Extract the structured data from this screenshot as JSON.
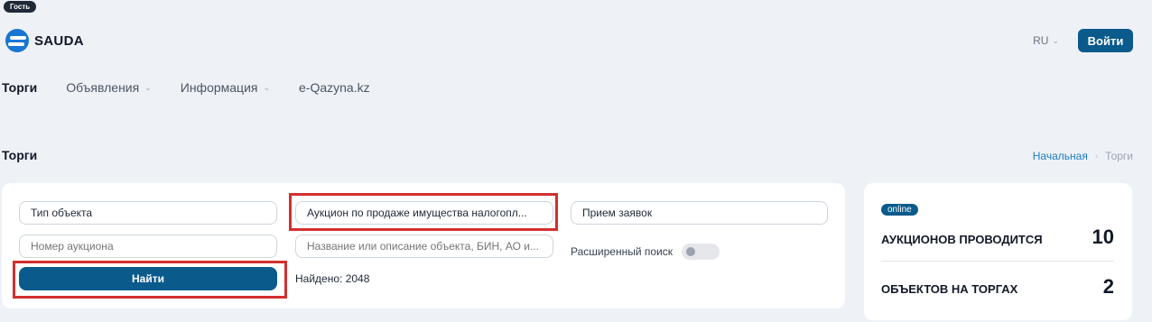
{
  "header": {
    "guest_badge": "Гость",
    "logo_text": "SAUDA",
    "language": "RU",
    "login_label": "Войти"
  },
  "nav": {
    "items": [
      {
        "label": "Торги"
      },
      {
        "label": "Объявления"
      },
      {
        "label": "Информация"
      },
      {
        "label": "e-Qazyna.kz"
      }
    ]
  },
  "page": {
    "title": "Торги",
    "breadcrumb": {
      "home": "Начальная",
      "current": "Торги"
    }
  },
  "filters": {
    "object_type": "Тип объекта",
    "auction_type": "Аукцион по продаже имущества налогопл...",
    "status": "Прием заявок",
    "auction_number_placeholder": "Номер аукциона",
    "search_placeholder": "Название или описание объекта, БИН, АО и...",
    "advanced_search_label": "Расширенный поиск",
    "find_label": "Найти",
    "found_text": "Найдено: 2048"
  },
  "stats": {
    "online_badge": "online",
    "auctions_label": "АУКЦИОНОВ ПРОВОДИТСЯ",
    "auctions_value": "10",
    "objects_label": "ОБЪЕКТОВ НА ТОРГАХ",
    "objects_value": "2"
  },
  "colors": {
    "primary": "#0b5a8c",
    "highlight": "#d32f2f",
    "link": "#1e7bc4"
  }
}
